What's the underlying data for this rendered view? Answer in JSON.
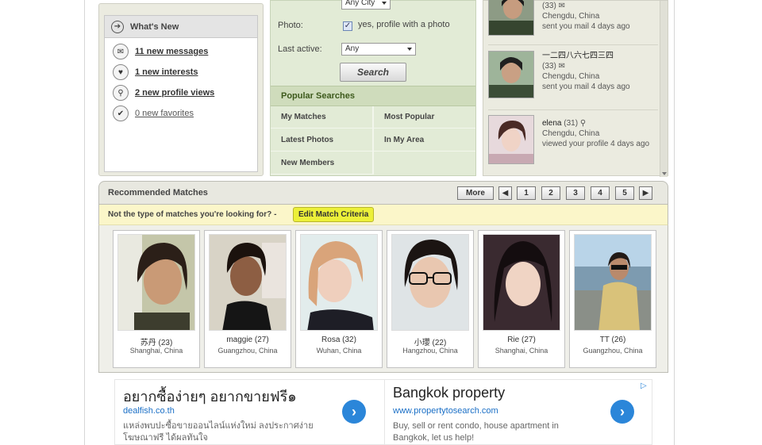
{
  "whats_new": {
    "title": "What's New",
    "items": [
      {
        "label": "11 new messages",
        "icon": "envelope-icon"
      },
      {
        "label": "1 new interests",
        "icon": "heart-icon"
      },
      {
        "label": "2 new profile views",
        "icon": "magnifier-icon"
      },
      {
        "label": "0 new favorites",
        "icon": "checkmark-icon"
      }
    ]
  },
  "search": {
    "city_value": "Any City",
    "photo_label": "Photo:",
    "photo_checkbox_text": "yes, profile with a photo",
    "photo_checked": true,
    "last_active_label": "Last active:",
    "last_active_value": "Any",
    "button_label": "Search"
  },
  "popular_searches": {
    "title": "Popular Searches",
    "items": [
      "My Matches",
      "Most Popular",
      "Latest Photos",
      "In My Area",
      "New Members"
    ]
  },
  "activity": [
    {
      "age_text": "(33)",
      "location": "Chengdu, China",
      "action": "sent you mail 4 days ago"
    },
    {
      "name": "一二四八六七四三四",
      "age_text": "(33)",
      "location": "Chengdu, China",
      "action": "sent you mail 4 days ago"
    },
    {
      "name": "elena",
      "age_text": "(31)",
      "location": "Chengdu, China",
      "action": "viewed your profile 4 days ago"
    }
  ],
  "recommended": {
    "title": "Recommended Matches",
    "more_label": "More",
    "pages": [
      "1",
      "2",
      "3",
      "4",
      "5"
    ],
    "criteria_text": "Not the type of matches you're looking for? -",
    "criteria_button": "Edit Match Criteria",
    "matches": [
      {
        "name": "苏丹 (23)",
        "location": "Shanghai, China"
      },
      {
        "name": "maggie (27)",
        "location": "Guangzhou, China"
      },
      {
        "name": "Rosa (32)",
        "location": "Wuhan, China"
      },
      {
        "name": "小瓔 (22)",
        "location": "Hangzhou, China"
      },
      {
        "name": "Rie (27)",
        "location": "Shanghai, China"
      },
      {
        "name": "TT (26)",
        "location": "Guangzhou, China"
      }
    ]
  },
  "ads": [
    {
      "title": "อยากซื้อง่ายๆ อยากขายฟรี๑",
      "url": "dealfish.co.th",
      "desc_line1": "แหล่งพบปะซื้อขายออนไลน์แห่งใหม่ ลงประกาศง่าย",
      "desc_line2": "โฆษณาฟรี ได้ผลทันใจ"
    },
    {
      "title": "Bangkok property",
      "url": "www.propertytosearch.com",
      "desc_line1": "Buy, sell or rent condo, house apartment in",
      "desc_line2": "Bangkok, let us help!"
    }
  ],
  "colors": {
    "search_bg": "#e2ebd6",
    "criteria_bg": "#fbf6c9",
    "criteria_button": "#ecf039",
    "ad_link": "#1a6fc6"
  }
}
